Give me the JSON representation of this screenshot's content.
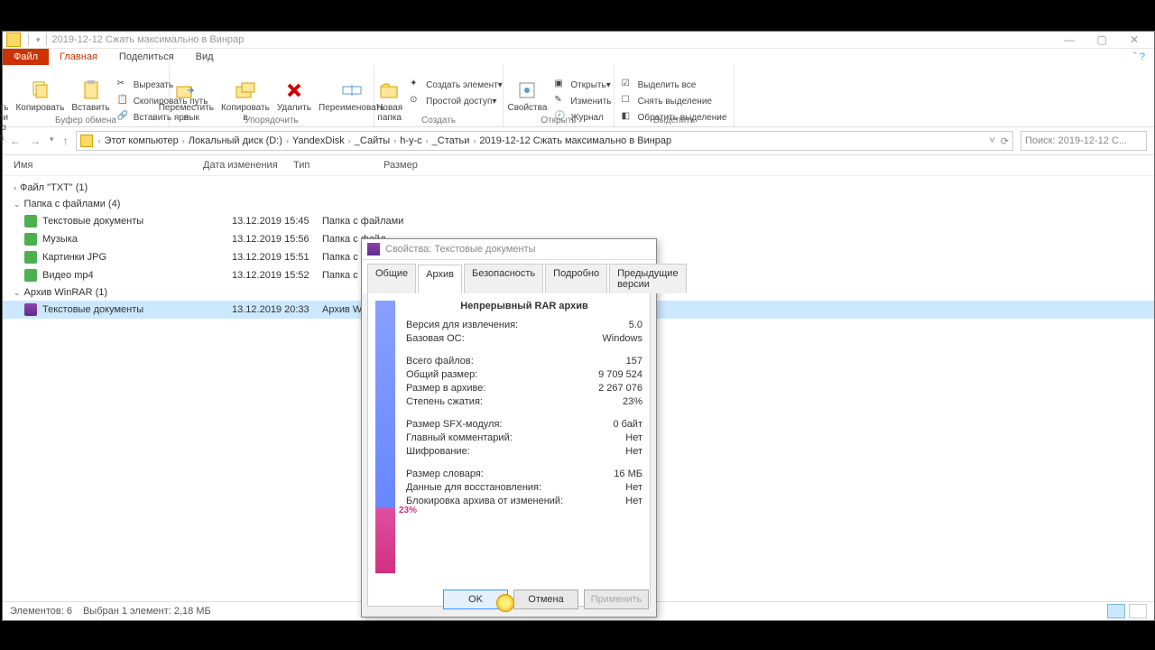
{
  "window": {
    "title": "2019-12-12 Сжать максимально в Винрар",
    "min": "—",
    "max": "▢",
    "close": "✕"
  },
  "ribbon": {
    "file": "Файл",
    "tabs": [
      "Главная",
      "Поделиться",
      "Вид"
    ],
    "g1_label": "Буфер обмена",
    "pin": "Закрепить на панели\nбыстрого доступа",
    "copy": "Копировать",
    "paste": "Вставить",
    "cut": "Вырезать",
    "copypath": "Скопировать путь",
    "pastelnk": "Вставить ярлык",
    "g2_label": "Упорядочить",
    "moveto": "Переместить\nв",
    "copyto": "Копировать\nв",
    "delete": "Удалить",
    "rename": "Переименовать",
    "g3_label": "Создать",
    "newfolder": "Новая\nпапка",
    "newitem": "Создать элемент",
    "easyaccess": "Простой доступ",
    "g4_label": "Открыть",
    "props": "Свойства",
    "open": "Открыть",
    "edit": "Изменить",
    "history": "Журнал",
    "g5_label": "Выделить",
    "selall": "Выделить все",
    "selnone": "Снять выделение",
    "selinv": "Обратить выделение"
  },
  "nav": {
    "crumbs": [
      "Этот компьютер",
      "Локальный диск (D:)",
      "YandexDisk",
      "_Сайты",
      "h-y-c",
      "_Статьи",
      "2019-12-12 Сжать максимально в Винрар"
    ],
    "search_ph": "Поиск: 2019-12-12 С..."
  },
  "cols": {
    "name": "Имя",
    "date": "Дата изменения",
    "type": "Тип",
    "size": "Размер"
  },
  "groups": [
    {
      "label": "Файл \"TXT\" (1)"
    },
    {
      "label": "Папка с файлами (4)",
      "items": [
        {
          "name": "Текстовые документы",
          "date": "13.12.2019 15:45",
          "type": "Папка с файлами"
        },
        {
          "name": "Музыка",
          "date": "13.12.2019 15:56",
          "type": "Папка с файл"
        },
        {
          "name": "Картинки JPG",
          "date": "13.12.2019 15:51",
          "type": "Папка с файл"
        },
        {
          "name": "Видео mp4",
          "date": "13.12.2019 15:52",
          "type": "Папка с файл"
        }
      ]
    },
    {
      "label": "Архив WinRAR (1)",
      "items": [
        {
          "name": "Текстовые документы",
          "date": "13.12.2019 20:33",
          "type": "Архив WinRAR",
          "sel": true
        }
      ]
    }
  ],
  "status": {
    "items": "Элементов: 6",
    "sel": "Выбран 1 элемент: 2,18 МБ"
  },
  "dialog": {
    "title": "Свойства: Текстовые документы",
    "tabs": [
      "Общие",
      "Архив",
      "Безопасность",
      "Подробно",
      "Предыдущие версии"
    ],
    "heading": "Непрерывный RAR архив",
    "rows": [
      {
        "k": "Версия для извлечения:",
        "v": "5.0"
      },
      {
        "k": "Базовая ОС:",
        "v": "Windows"
      },
      {
        "gap": true
      },
      {
        "k": "Всего файлов:",
        "v": "157"
      },
      {
        "k": "Общий размер:",
        "v": "9 709 524"
      },
      {
        "k": "Размер в архиве:",
        "v": "2 267 076"
      },
      {
        "k": "Степень сжатия:",
        "v": "23%"
      },
      {
        "gap": true
      },
      {
        "k": "Размер SFX-модуля:",
        "v": "0 байт"
      },
      {
        "k": "Главный комментарий:",
        "v": "Нет"
      },
      {
        "k": "Шифрование:",
        "v": "Нет"
      },
      {
        "gap": true
      },
      {
        "k": "Размер словаря:",
        "v": "16 МБ"
      },
      {
        "k": "Данные для восстановления:",
        "v": "Нет"
      },
      {
        "k": "Блокировка архива от изменений:",
        "v": "Нет"
      }
    ],
    "ratio": "23%",
    "ok": "OK",
    "cancel": "Отмена",
    "apply": "Применить"
  }
}
